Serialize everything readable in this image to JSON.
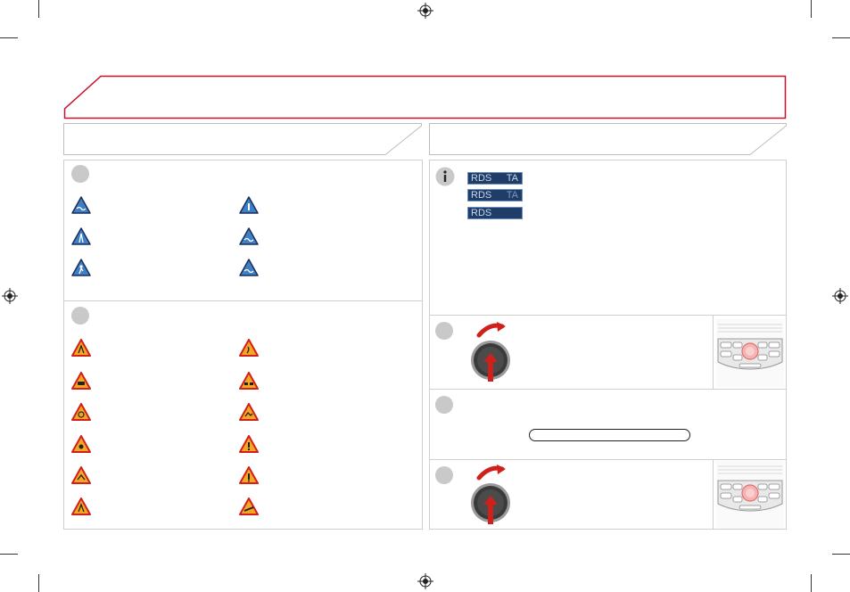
{
  "page": {
    "title": "",
    "left_section_heading": "",
    "right_section_heading": ""
  },
  "warning_signs": {
    "blue_signs": [
      "wave-sign-icon",
      "info-sign-icon",
      "road-sign-icon",
      "wave-sign-icon",
      "person-sign-icon",
      "wave-sign-icon"
    ],
    "red_signs": [
      "road-works-icon",
      "slippery-road-icon",
      "car-crash-icon",
      "traffic-jam-icon",
      "hazard-dot-icon",
      "thermometer-icon",
      "car-icon",
      "exclamation-icon",
      "person-icon",
      "car-skid-icon",
      "road-works-icon",
      "car-skid-icon"
    ]
  },
  "rds_displays": [
    {
      "left": "RDS",
      "right": "TA"
    },
    {
      "left": "RDS",
      "right": "TA"
    },
    {
      "left": "RDS",
      "right": ""
    }
  ],
  "colors": {
    "accent_red": "#c8102e",
    "bullet_grey": "#c9c9c9",
    "rds_blue": "#1f3d67",
    "sign_blue": "#3f7fc4",
    "sign_red": "#d0201c",
    "sign_orange": "#f5a623"
  }
}
